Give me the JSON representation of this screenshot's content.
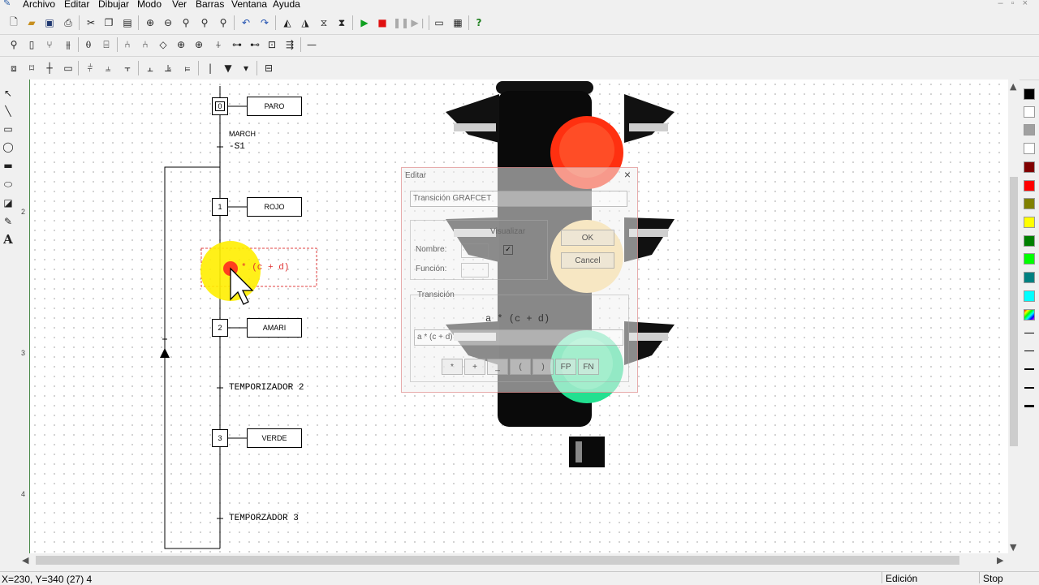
{
  "menu": {
    "items": [
      "Archivo",
      "Editar",
      "Dibujar",
      "Modo",
      "Ver",
      "Barras",
      "Ventana",
      "Ayuda"
    ]
  },
  "toolbar1": {
    "icons": [
      "new-icon",
      "open-icon",
      "save-icon",
      "print-icon",
      "cut-icon",
      "copy-icon",
      "paste-icon",
      "zoom-icon",
      "zoom-icon",
      "zoom-icon",
      "zoom-icon",
      "zoom-icon",
      "undo-icon",
      "redo-icon",
      "flip-icon",
      "flip-icon",
      "flip-icon",
      "flip-icon",
      "run-icon",
      "stop-icon",
      "pause-icon",
      "step-icon",
      "window-icon",
      "window-icon",
      "help-icon"
    ]
  },
  "ruler": {
    "labels": [
      "2",
      "3",
      "4"
    ]
  },
  "grafcet": {
    "steps": [
      {
        "number": "0",
        "action": "PARO"
      },
      {
        "number": "1",
        "action": "ROJO"
      },
      {
        "number": "2",
        "action": "AMARI"
      },
      {
        "number": "3",
        "action": "VERDE"
      }
    ],
    "transitions": {
      "t0_top": "MARCH",
      "t0_bottom": "-S1",
      "t1": "* (c + d)",
      "t2": "TEMPORIZADOR 2",
      "t3": "TEMPORZADOR 3"
    }
  },
  "dialog": {
    "title": "Editar",
    "close": "×",
    "type_field": "Transición GRAFCET",
    "group_visualizar": "Visualizar",
    "label_nombre": "Nombre:",
    "label_funcion": "Función:",
    "ok": "OK",
    "cancel": "Cancel",
    "group_transicion": "Transición",
    "preview": "a * (c + d)",
    "expression": "a * (c + d)",
    "ops": [
      "*",
      "+",
      "_",
      "(",
      ")",
      "FP",
      "FN"
    ]
  },
  "palette_colors": [
    "#000000",
    "#ffffff",
    "#a0a0a0",
    "#ffffff",
    "#800000",
    "#ff0000",
    "#808000",
    "#ffff00",
    "#008000",
    "#00ff00",
    "#008080",
    "#00ffff"
  ],
  "status": {
    "coords": "X=230, Y=340 (27) 4",
    "mode": "Edición",
    "state": "Stop"
  }
}
